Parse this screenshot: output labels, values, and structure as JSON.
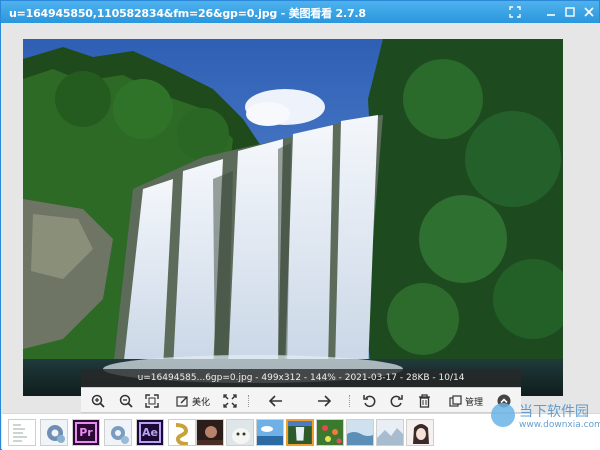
{
  "window": {
    "title": "u=164945850,110582834&fm=26&gp=0.jpg - 美图看看 2.7.8",
    "accent": "#2a96dc"
  },
  "image_info": "u=16494585...6gp=0.jpg - 499x312 - 144% - 2021-03-17 - 28KB - 10/14",
  "toolbar": {
    "zoom_in_icon": "zoom-in-icon",
    "zoom_out_icon": "zoom-out-icon",
    "fit_icon": "fit-window-icon",
    "beautify_label": "美化",
    "fullscreen_icon": "fullscreen-icon",
    "prev_icon": "arrow-left-icon",
    "next_icon": "arrow-right-icon",
    "rotate_left_icon": "rotate-left-icon",
    "rotate_right_icon": "rotate-right-icon",
    "delete_icon": "trash-icon",
    "manage_label": "管理",
    "collapse_icon": "chevron-up-icon"
  },
  "thumbnails": [
    {
      "kind": "doc",
      "text": ""
    },
    {
      "kind": "gear",
      "text": ""
    },
    {
      "kind": "pr",
      "text": "Pr"
    },
    {
      "kind": "gear",
      "text": ""
    },
    {
      "kind": "ae",
      "text": "Ae"
    },
    {
      "kind": "scroll",
      "text": ""
    },
    {
      "kind": "photo-dark",
      "text": ""
    },
    {
      "kind": "photo-cat",
      "text": ""
    },
    {
      "kind": "photo-sky",
      "text": ""
    },
    {
      "kind": "photo-falls",
      "text": "",
      "selected": true
    },
    {
      "kind": "photo-flowers",
      "text": ""
    },
    {
      "kind": "photo-water",
      "text": ""
    },
    {
      "kind": "photo-snow",
      "text": ""
    },
    {
      "kind": "photo-anime",
      "text": ""
    }
  ],
  "watermark": {
    "text": "当下软件园",
    "url": "www.downxia.com"
  }
}
